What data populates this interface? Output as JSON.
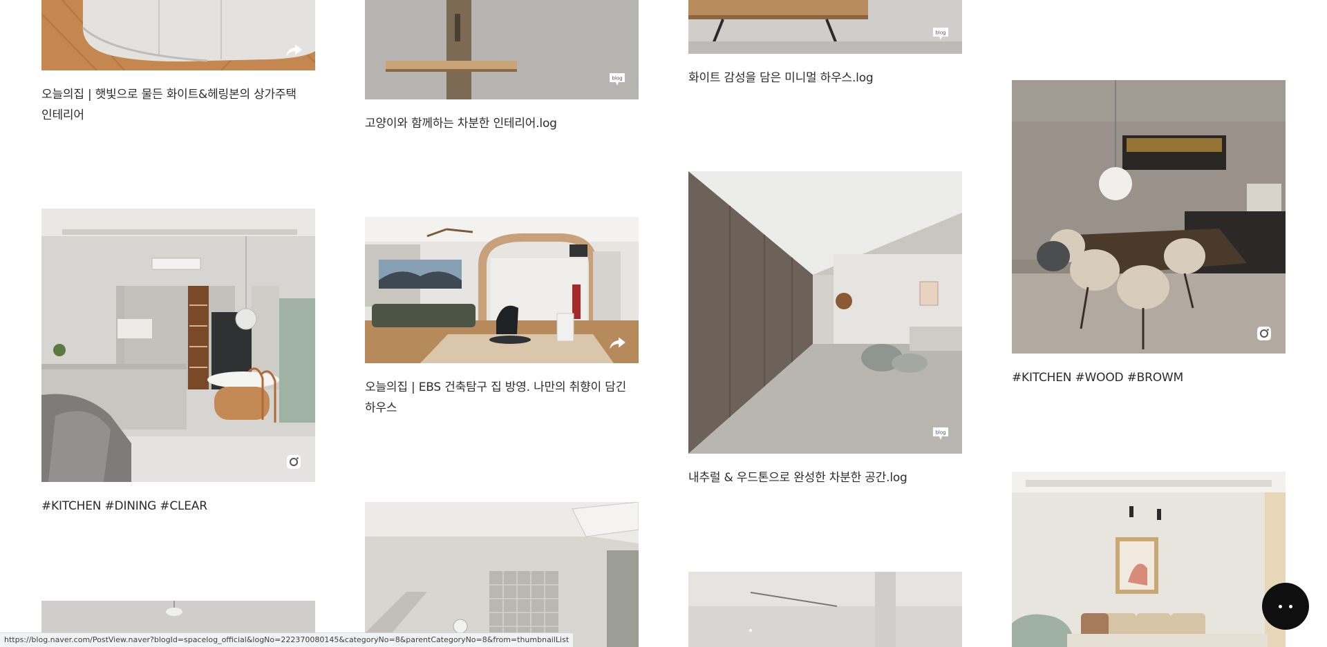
{
  "gallery": {
    "cards": [
      {
        "caption": "오늘의집 | 햇빛으로 물든 화이트&헤링본의 상가주택\n인테리어",
        "badge_icon": "share-icon"
      },
      {
        "caption": "고양이와 함께하는 차분한 인테리어.log",
        "badge_icon": "blog-icon"
      },
      {
        "caption": "화이트 감성을 담은 미니멀 하우스.log",
        "badge_icon": "blog-icon"
      },
      {
        "caption": "#KITCHEN #DINING #CLEAR",
        "badge_icon": "instagram-icon"
      },
      {
        "caption": "오늘의집 | EBS 건축탐구 집 방영. 나만의 취향이 담긴\n하우스",
        "badge_icon": "share-icon"
      },
      {
        "caption": "내추럴 & 우드톤으로 완성한 차분한 공간.log",
        "badge_icon": "blog-icon"
      },
      {
        "caption": "#KITCHEN #WOOD #BROWM",
        "badge_icon": "instagram-icon"
      }
    ],
    "blog_badge_text": "blog"
  },
  "status_bar": {
    "url": "https://blog.naver.com/PostView.naver?blogId=spacelog_official&logNo=222370080145&categoryNo=8&parentCategoryNo=8&from=thumbnailList"
  },
  "colors": {
    "fab_background": "#0f0f0f",
    "page_background": "#ffffff"
  }
}
